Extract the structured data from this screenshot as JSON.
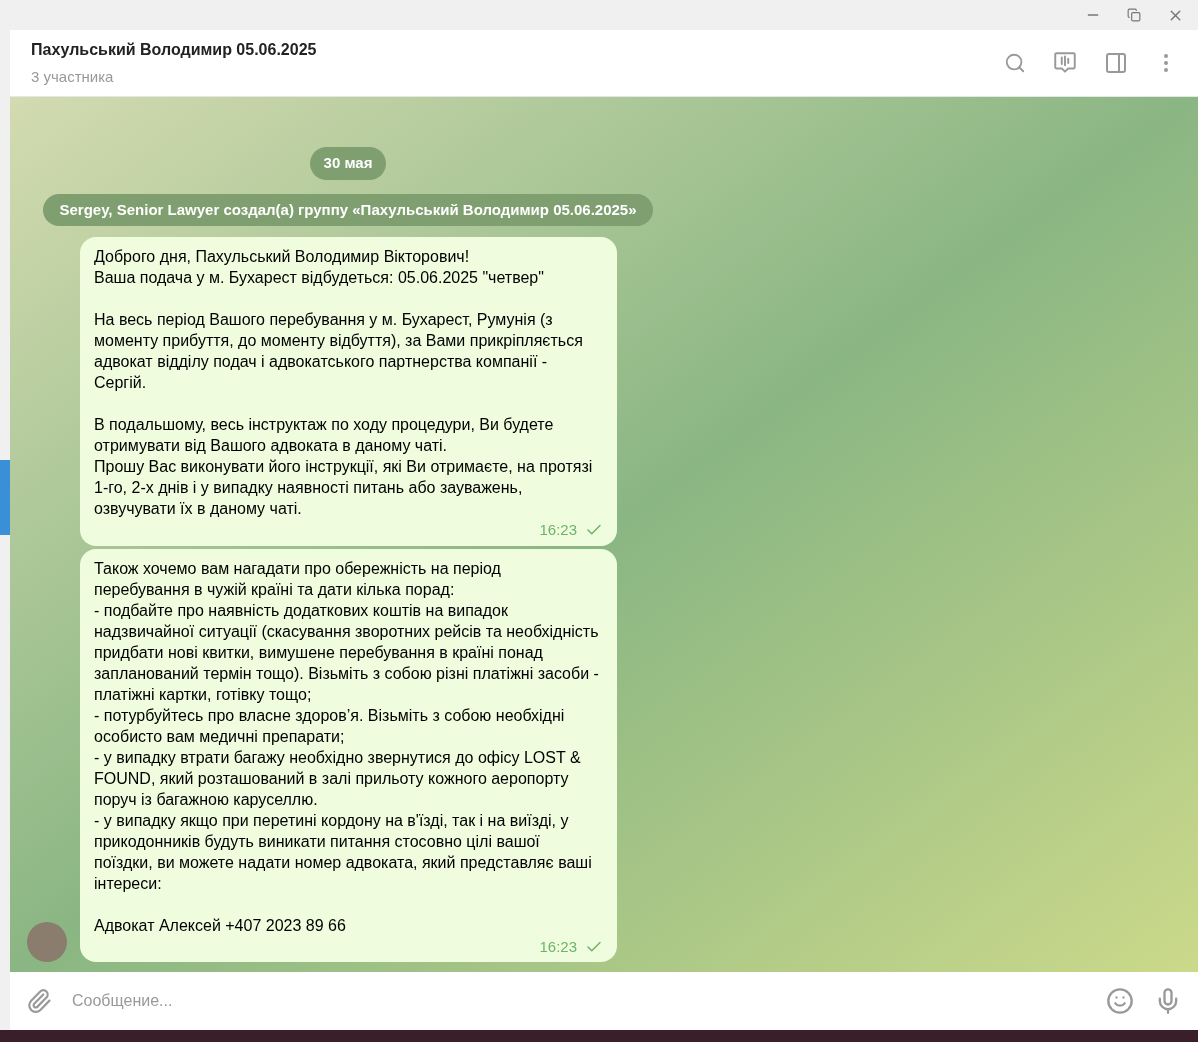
{
  "header": {
    "title": "Пахульський Володимир 05.06.2025",
    "subtitle": "3 участника"
  },
  "date_badge": "30 мая",
  "service_message": "Sergey, Senior Lawyer создал(а) группу «Пахульський Володимир 05.06.2025»",
  "messages": [
    {
      "text": "Доброго дня, Пахульський Володимир Вікторович!\nВаша подача у м. Бухарест відбудеться: 05.06.2025 \"четвер\"\n\nНа весь період Вашого перебування у м. Бухарест, Румунія (з моменту прибуття, до моменту відбуття), за Вами прикріпляється адвокат відділу подач і адвокатського партнерства компанії - Сергій.\n\nВ подальшому, весь інструктаж по ходу процедури, Ви будете отримувати від Вашого адвоката в даному чаті.\nПрошу Вас виконувати його інструкції, які Ви отримаєте, на протязі 1-го, 2-х днів і у випадку наявності питань або зауважень, озвучувати їх в даному чаті.",
      "time": "16:23",
      "read": false,
      "avatar": false
    },
    {
      "text": "Також хочемо вам нагадати про обережність на період перебування в чужій країні та дати кілька порад:\n- подбайте про наявність додаткових коштів на випадок надзвичайної ситуації (скасування зворотних рейсів та необхідність придбати нові квитки, вимушене перебування в країні понад запланований термін тощо). Візьміть з собою різні платіжні засоби - платіжні картки, готівку тощо;\n- потурбуйтесь про власне здоров’я. Візьміть з собою необхідні особисто вам медичні препарати;\n- у випадку втрати багажу необхідно звернутися до офісу LOST & FOUND, який розташований в залі прильоту кожного аеропорту поруч із багажною каруселлю.\n- у випадку якщо при перетині кордону на в'їзді, так і на виїзді, у прикодонників будуть виникати питання стосовно цілі вашої поїздки, ви можете надати номер адвоката, який представляє ваші інтереси:\n\nАдвокат Алексей +407 2023 89 66",
      "time": "16:23",
      "read": false,
      "avatar": true
    }
  ],
  "composer": {
    "placeholder": "Сообщение..."
  }
}
